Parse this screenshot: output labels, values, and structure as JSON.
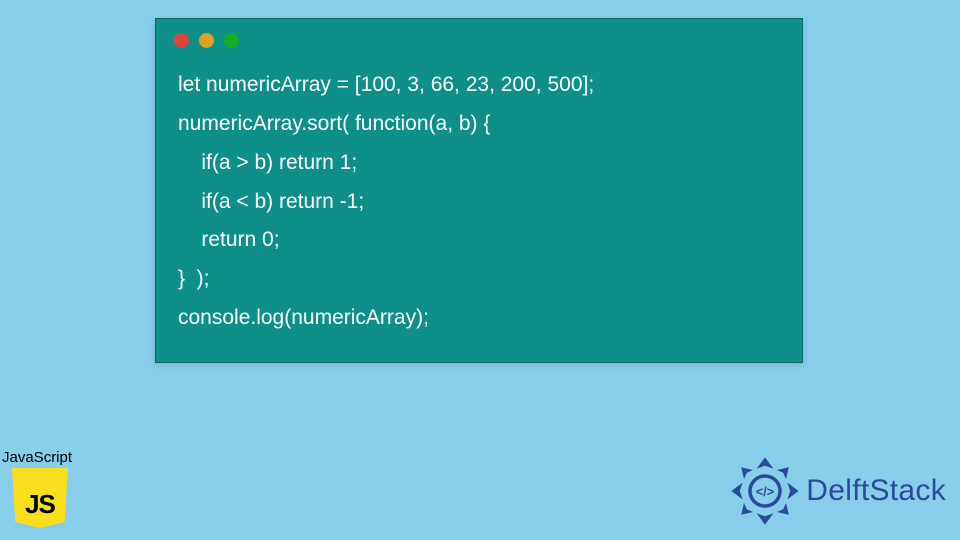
{
  "code": {
    "lines": [
      "let numericArray = [100, 3, 66, 23, 200, 500];",
      "numericArray.sort( function(a, b) {",
      "    if(a > b) return 1;",
      "    if(a < b) return -1;",
      "    return 0;",
      "}  );",
      "console.log(numericArray);"
    ]
  },
  "badges": {
    "js_label": "JavaScript",
    "js_logo_text": "JS",
    "delft_text": "DelftStack"
  },
  "colors": {
    "background": "#87ceeb",
    "window_bg": "#0e9088",
    "dot_red": "#e0443e",
    "dot_yellow": "#dea123",
    "dot_green": "#1aab29",
    "js_yellow": "#f7df1e",
    "delft_blue": "#2b4a9e"
  }
}
